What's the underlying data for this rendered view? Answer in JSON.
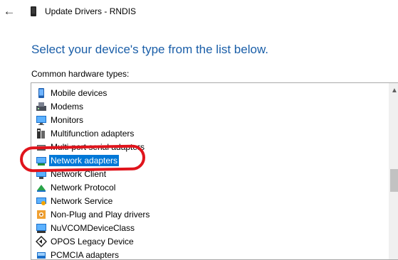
{
  "window": {
    "title": "Update Drivers - RNDIS"
  },
  "heading": "Select your device's type from the list below.",
  "list_label": "Common hardware types:",
  "list": {
    "items": [
      {
        "label": "Mobile devices",
        "icon": "mobile-device-icon",
        "selected": false
      },
      {
        "label": "Modems",
        "icon": "modem-icon",
        "selected": false
      },
      {
        "label": "Monitors",
        "icon": "monitor-icon",
        "selected": false
      },
      {
        "label": "Multifunction adapters",
        "icon": "multifunction-adapter-icon",
        "selected": false
      },
      {
        "label": "Multi-port serial adapters",
        "icon": "serial-adapter-icon",
        "selected": false
      },
      {
        "label": "Network adapters",
        "icon": "network-adapter-icon",
        "selected": true
      },
      {
        "label": "Network Client",
        "icon": "network-client-icon",
        "selected": false
      },
      {
        "label": "Network Protocol",
        "icon": "network-protocol-icon",
        "selected": false
      },
      {
        "label": "Network Service",
        "icon": "network-service-icon",
        "selected": false
      },
      {
        "label": "Non-Plug and Play drivers",
        "icon": "non-pnp-driver-icon",
        "selected": false
      },
      {
        "label": "NuVCOMDeviceClass",
        "icon": "device-class-icon",
        "selected": false
      },
      {
        "label": "OPOS Legacy Device",
        "icon": "opos-device-icon",
        "selected": false
      },
      {
        "label": "PCMCIA adapters",
        "icon": "pcmcia-adapter-icon",
        "selected": false
      }
    ]
  },
  "colors": {
    "heading": "#1a5ea8",
    "selection": "#0078d7",
    "annotation": "#e0141c"
  }
}
